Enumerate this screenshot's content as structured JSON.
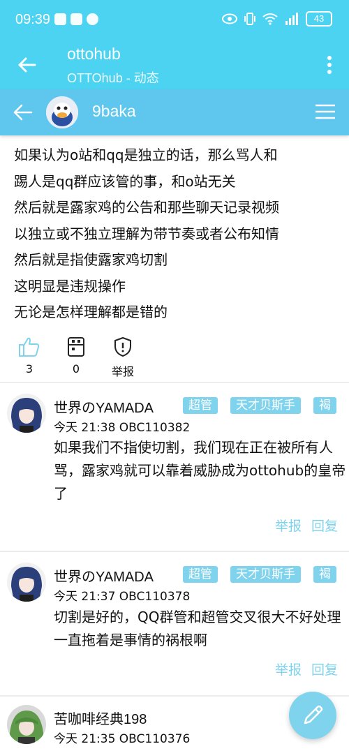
{
  "status": {
    "time": "09:39",
    "battery": "43"
  },
  "app_bar": {
    "title": "ottohub",
    "subtitle": "OTTOhub - 动态"
  },
  "user_bar": {
    "username": "9baka"
  },
  "post": {
    "lines": [
      "如果认为o站和qq是独立的话，那么骂人和",
      "踢人是qq群应该管的事，和o站无关",
      "然后就是露家鸡的公告和那些聊天记录视频",
      "以独立或不独立理解为带节奏或者公布知情",
      "然后就是指使露家鸡切割",
      "这明显是违规操作",
      "无论是怎样理解都是错的"
    ],
    "likes": "3",
    "favorites": "0",
    "report_label": "举报"
  },
  "comments": [
    {
      "author": "世界のYAMADA",
      "tags": [
        "超管",
        "天才贝斯手",
        "褐"
      ],
      "meta": "今天 21:38 OBC110382",
      "text": "如果我们不指使切割，我们现在正在被所有人骂，露家鸡就可以靠着威胁成为ottohub的皇帝了",
      "report": "举报",
      "reply": "回复"
    },
    {
      "author": "世界のYAMADA",
      "tags": [
        "超管",
        "天才贝斯手",
        "褐"
      ],
      "meta": "今天 21:37 OBC110378",
      "text": "切割是好的，QQ群管和超管交叉很大不好处理一直拖着是事情的祸根啊",
      "report": "举报",
      "reply": "回复"
    },
    {
      "author": "苦咖啡经典198",
      "meta": "今天 21:35 OBC110376"
    }
  ],
  "colors": {
    "primary": "#4cd3f1",
    "secondary": "#5fc7ee",
    "accent": "#7fd3ec"
  }
}
